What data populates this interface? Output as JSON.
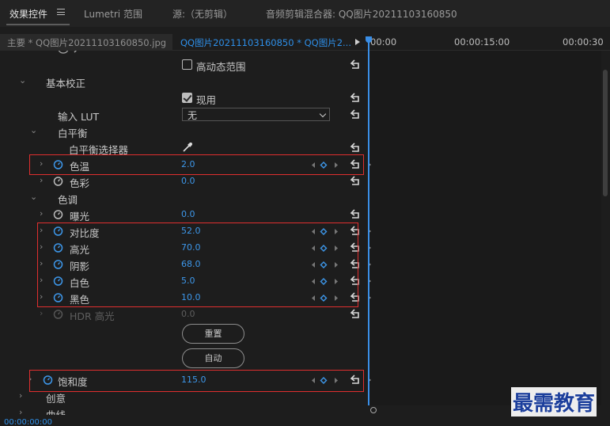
{
  "tabs": {
    "effect_controls": "效果控件",
    "lumetri_scopes": "Lumetri 范围",
    "source": "源:（无剪辑）",
    "audio_mixer": "音频剪辑混合器: QQ图片20211103160850"
  },
  "clipbar": {
    "master": "主要 * QQ图片20211103160850.jpg",
    "clip": "QQ图片20211103160850 * QQ图片2...",
    "timecodes": [
      "00:00",
      "00:00:15:00",
      "00:00:30"
    ]
  },
  "properties": {
    "high_dynamic_range_label": "高动态范围",
    "basic_correction": "基本校正",
    "enable_label": "现用",
    "input_lut": {
      "label": "输入 LUT",
      "value": "无"
    },
    "white_balance": "白平衡",
    "wb_selector": "白平衡选择器",
    "temperature": {
      "label": "色温",
      "value": "2.0"
    },
    "tint": {
      "label": "色彩",
      "value": "0.0"
    },
    "tone": "色调",
    "exposure": {
      "label": "曝光",
      "value": "0.0"
    },
    "contrast": {
      "label": "对比度",
      "value": "52.0"
    },
    "highlights": {
      "label": "高光",
      "value": "70.0"
    },
    "shadows": {
      "label": "阴影",
      "value": "68.0"
    },
    "whites": {
      "label": "白色",
      "value": "5.0"
    },
    "blacks": {
      "label": "黑色",
      "value": "10.0"
    },
    "hdr_highlights": {
      "label": "HDR 高光",
      "value": "0.0"
    },
    "reset_button": "重置",
    "auto_button": "自动",
    "saturation": {
      "label": "饱和度",
      "value": "115.0"
    },
    "creative": "创意",
    "curves": "曲线"
  },
  "bottom": {
    "time": "00:00:00:00"
  },
  "watermark": "最需教育",
  "colors": {
    "accent_blue": "#2e8fe8",
    "highlight_red": "#e02f2f"
  }
}
